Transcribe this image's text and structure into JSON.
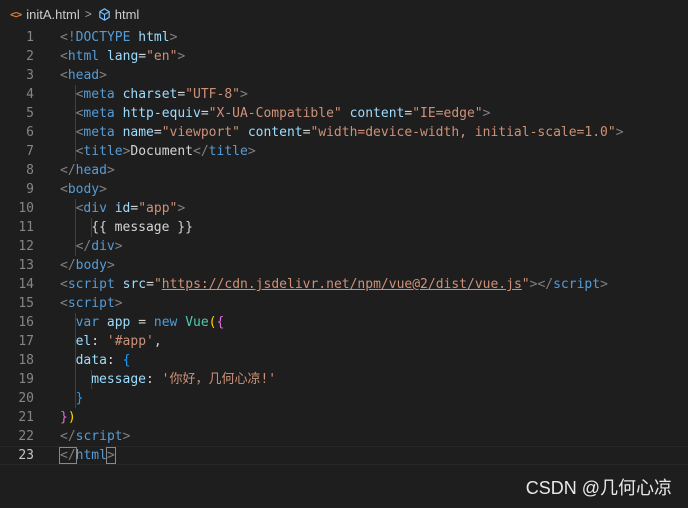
{
  "breadcrumb": {
    "file_icon": "<>",
    "file_name": "initA.html",
    "separator": ">",
    "element_icon": "html-element-icon",
    "element_name": "html"
  },
  "colors": {
    "background": "#1e1e1e",
    "tag": "#569cd6",
    "bracket": "#808080",
    "attribute": "#9cdcfe",
    "string": "#ce9178",
    "text": "#d4d4d4",
    "line_number": "#858585",
    "brace_gold": "#ffd700",
    "brace_purple": "#da70d6",
    "brace_blue": "#179fff",
    "class": "#4ec9b0",
    "function": "#dcdcaa",
    "file_icon": "#e37933",
    "element_icon": "#75beff"
  },
  "editor": {
    "current_line": 23,
    "lines": [
      {
        "n": "1",
        "indent": 0,
        "tokens": [
          {
            "t": "<!",
            "c": "bracket"
          },
          {
            "t": "DOCTYPE",
            "c": "tag"
          },
          {
            "t": " ",
            "c": "text"
          },
          {
            "t": "html",
            "c": "attr"
          },
          {
            "t": ">",
            "c": "bracket"
          }
        ]
      },
      {
        "n": "2",
        "indent": 0,
        "tokens": [
          {
            "t": "<",
            "c": "bracket"
          },
          {
            "t": "html",
            "c": "tag"
          },
          {
            "t": " ",
            "c": "text"
          },
          {
            "t": "lang",
            "c": "attr"
          },
          {
            "t": "=",
            "c": "text"
          },
          {
            "t": "\"en\"",
            "c": "string"
          },
          {
            "t": ">",
            "c": "bracket"
          }
        ]
      },
      {
        "n": "3",
        "indent": 0,
        "tokens": [
          {
            "t": "<",
            "c": "bracket"
          },
          {
            "t": "head",
            "c": "tag"
          },
          {
            "t": ">",
            "c": "bracket"
          }
        ]
      },
      {
        "n": "4",
        "indent": 1,
        "tokens": [
          {
            "t": "<",
            "c": "bracket"
          },
          {
            "t": "meta",
            "c": "tag"
          },
          {
            "t": " ",
            "c": "text"
          },
          {
            "t": "charset",
            "c": "attr"
          },
          {
            "t": "=",
            "c": "text"
          },
          {
            "t": "\"UTF-8\"",
            "c": "string"
          },
          {
            "t": ">",
            "c": "bracket"
          }
        ]
      },
      {
        "n": "5",
        "indent": 1,
        "tokens": [
          {
            "t": "<",
            "c": "bracket"
          },
          {
            "t": "meta",
            "c": "tag"
          },
          {
            "t": " ",
            "c": "text"
          },
          {
            "t": "http-equiv",
            "c": "attr"
          },
          {
            "t": "=",
            "c": "text"
          },
          {
            "t": "\"X-UA-Compatible\"",
            "c": "string"
          },
          {
            "t": " ",
            "c": "text"
          },
          {
            "t": "content",
            "c": "attr"
          },
          {
            "t": "=",
            "c": "text"
          },
          {
            "t": "\"IE=edge\"",
            "c": "string"
          },
          {
            "t": ">",
            "c": "bracket"
          }
        ]
      },
      {
        "n": "6",
        "indent": 1,
        "tokens": [
          {
            "t": "<",
            "c": "bracket"
          },
          {
            "t": "meta",
            "c": "tag"
          },
          {
            "t": " ",
            "c": "text"
          },
          {
            "t": "name",
            "c": "attr"
          },
          {
            "t": "=",
            "c": "text"
          },
          {
            "t": "\"viewport\"",
            "c": "string"
          },
          {
            "t": " ",
            "c": "text"
          },
          {
            "t": "content",
            "c": "attr"
          },
          {
            "t": "=",
            "c": "text"
          },
          {
            "t": "\"width=device-width, initial-scale=1.0\"",
            "c": "string"
          },
          {
            "t": ">",
            "c": "bracket"
          }
        ]
      },
      {
        "n": "7",
        "indent": 1,
        "tokens": [
          {
            "t": "<",
            "c": "bracket"
          },
          {
            "t": "title",
            "c": "tag"
          },
          {
            "t": ">",
            "c": "bracket"
          },
          {
            "t": "Document",
            "c": "text"
          },
          {
            "t": "</",
            "c": "bracket"
          },
          {
            "t": "title",
            "c": "tag"
          },
          {
            "t": ">",
            "c": "bracket"
          }
        ]
      },
      {
        "n": "8",
        "indent": 0,
        "tokens": [
          {
            "t": "</",
            "c": "bracket"
          },
          {
            "t": "head",
            "c": "tag"
          },
          {
            "t": ">",
            "c": "bracket"
          }
        ]
      },
      {
        "n": "9",
        "indent": 0,
        "tokens": [
          {
            "t": "<",
            "c": "bracket"
          },
          {
            "t": "body",
            "c": "tag"
          },
          {
            "t": ">",
            "c": "bracket"
          }
        ]
      },
      {
        "n": "10",
        "indent": 1,
        "tokens": [
          {
            "t": "<",
            "c": "bracket"
          },
          {
            "t": "div",
            "c": "tag"
          },
          {
            "t": " ",
            "c": "text"
          },
          {
            "t": "id",
            "c": "attr"
          },
          {
            "t": "=",
            "c": "text"
          },
          {
            "t": "\"app\"",
            "c": "string"
          },
          {
            "t": ">",
            "c": "bracket"
          }
        ]
      },
      {
        "n": "11",
        "indent": 2,
        "tokens": [
          {
            "t": "{{ message }}",
            "c": "text"
          }
        ]
      },
      {
        "n": "12",
        "indent": 1,
        "tokens": [
          {
            "t": "</",
            "c": "bracket"
          },
          {
            "t": "div",
            "c": "tag"
          },
          {
            "t": ">",
            "c": "bracket"
          }
        ]
      },
      {
        "n": "13",
        "indent": 0,
        "tokens": [
          {
            "t": "</",
            "c": "bracket"
          },
          {
            "t": "body",
            "c": "tag"
          },
          {
            "t": ">",
            "c": "bracket"
          }
        ]
      },
      {
        "n": "14",
        "indent": 0,
        "tokens": [
          {
            "t": "<",
            "c": "bracket"
          },
          {
            "t": "script",
            "c": "tag"
          },
          {
            "t": " ",
            "c": "text"
          },
          {
            "t": "src",
            "c": "attr"
          },
          {
            "t": "=",
            "c": "text"
          },
          {
            "t": "\"",
            "c": "string"
          },
          {
            "t": "https://cdn.jsdelivr.net/npm/vue@2/dist/vue.js",
            "c": "link"
          },
          {
            "t": "\"",
            "c": "string"
          },
          {
            "t": "></",
            "c": "bracket"
          },
          {
            "t": "script",
            "c": "tag"
          },
          {
            "t": ">",
            "c": "bracket"
          }
        ]
      },
      {
        "n": "15",
        "indent": 0,
        "tokens": [
          {
            "t": "<",
            "c": "bracket"
          },
          {
            "t": "script",
            "c": "tag"
          },
          {
            "t": ">",
            "c": "bracket"
          }
        ]
      },
      {
        "n": "16",
        "indent": 1,
        "tokens": [
          {
            "t": "var",
            "c": "tag"
          },
          {
            "t": " ",
            "c": "text"
          },
          {
            "t": "app",
            "c": "attr"
          },
          {
            "t": " = ",
            "c": "text"
          },
          {
            "t": "new",
            "c": "tag"
          },
          {
            "t": " ",
            "c": "text"
          },
          {
            "t": "Vue",
            "c": "class"
          },
          {
            "t": "(",
            "c": "gold"
          },
          {
            "t": "{",
            "c": "purple"
          }
        ]
      },
      {
        "n": "17",
        "indent": 1,
        "tokens": [
          {
            "t": "el",
            "c": "attr"
          },
          {
            "t": ": ",
            "c": "text"
          },
          {
            "t": "'#app'",
            "c": "string"
          },
          {
            "t": ",",
            "c": "text"
          }
        ]
      },
      {
        "n": "18",
        "indent": 1,
        "tokens": [
          {
            "t": "data",
            "c": "attr"
          },
          {
            "t": ": ",
            "c": "text"
          },
          {
            "t": "{",
            "c": "blue"
          }
        ]
      },
      {
        "n": "19",
        "indent": 2,
        "tokens": [
          {
            "t": "message",
            "c": "attr"
          },
          {
            "t": ": ",
            "c": "text"
          },
          {
            "t": "'你好，几何心凉!'",
            "c": "string"
          }
        ]
      },
      {
        "n": "20",
        "indent": 1,
        "tokens": [
          {
            "t": "}",
            "c": "blue"
          }
        ]
      },
      {
        "n": "21",
        "indent": 0,
        "tokens": [
          {
            "t": "}",
            "c": "purple"
          },
          {
            "t": ")",
            "c": "gold"
          }
        ]
      },
      {
        "n": "22",
        "indent": 0,
        "tokens": [
          {
            "t": "</",
            "c": "bracket"
          },
          {
            "t": "script",
            "c": "tag"
          },
          {
            "t": ">",
            "c": "bracket"
          }
        ]
      },
      {
        "n": "23",
        "indent": 0,
        "tokens": [
          {
            "t": "</",
            "c": "bracket-cursor"
          },
          {
            "t": "html",
            "c": "tag"
          },
          {
            "t": ">",
            "c": "bracket-cursor"
          }
        ]
      }
    ]
  },
  "watermark": "CSDN @几何心凉"
}
